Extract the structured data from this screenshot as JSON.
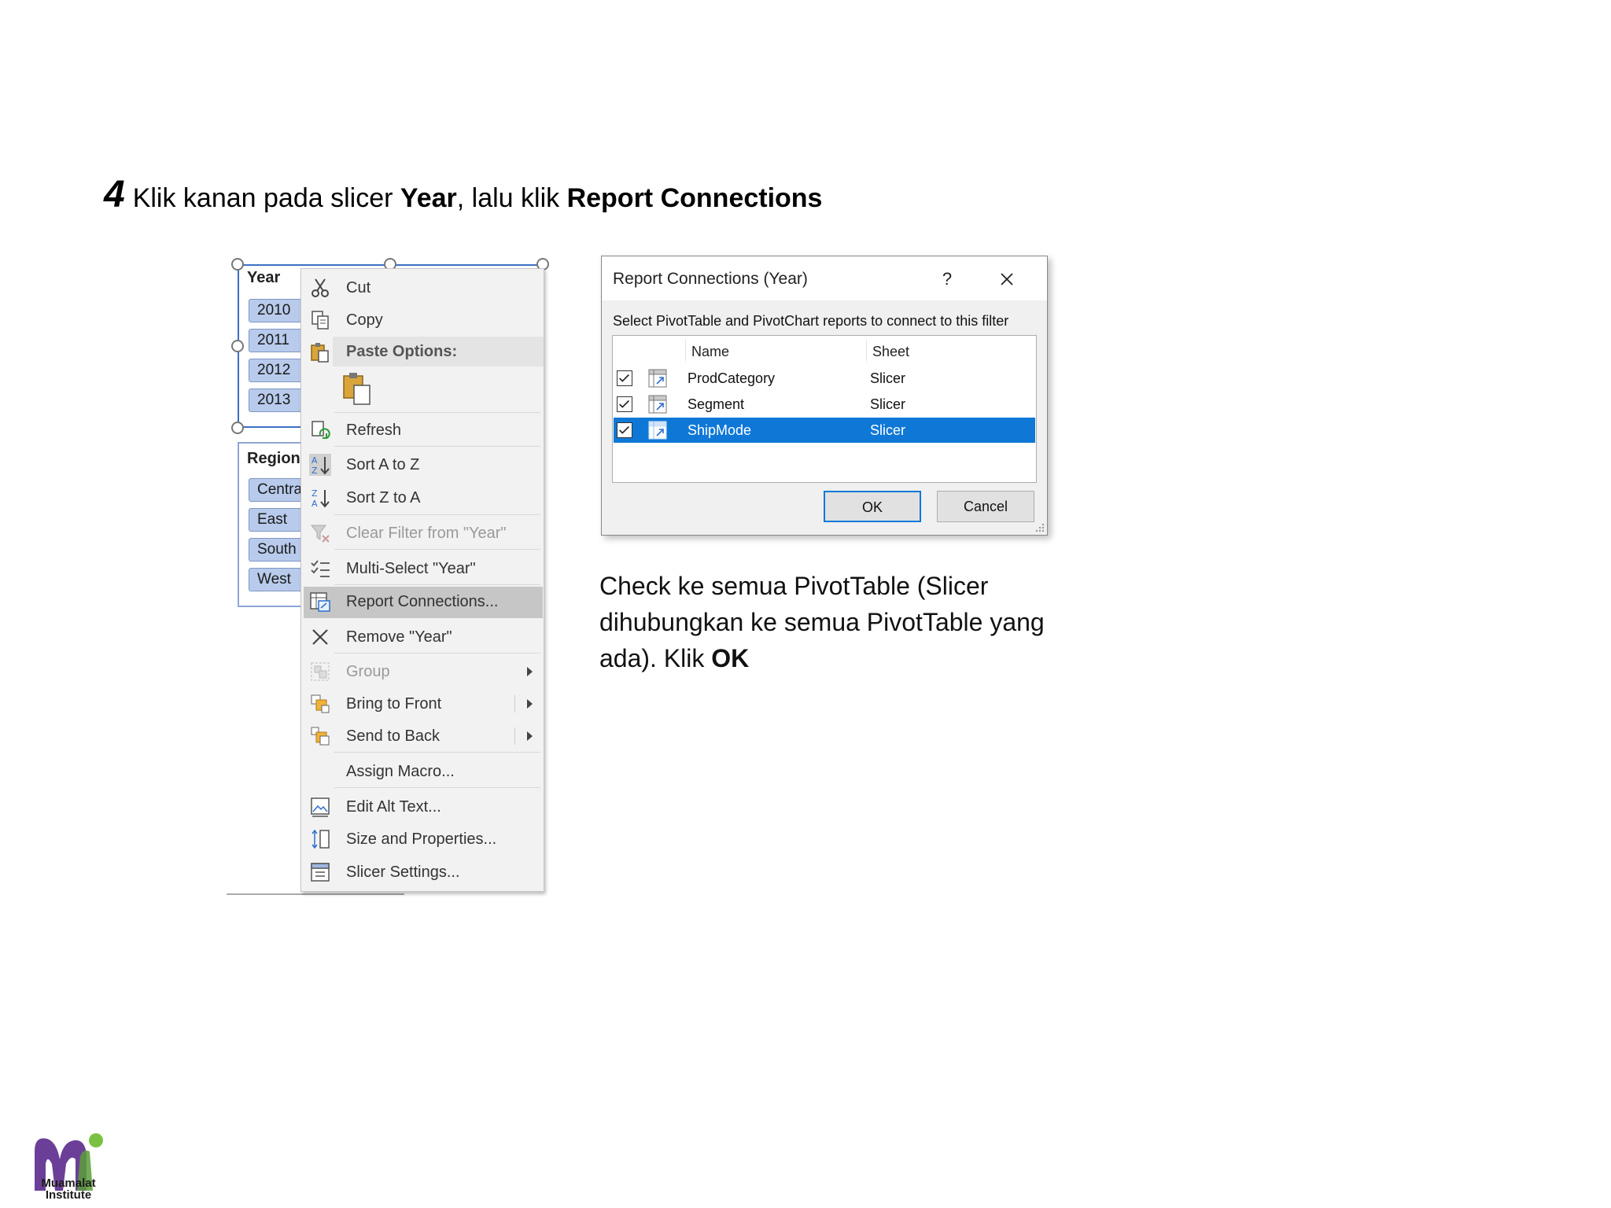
{
  "instruction": {
    "step_number": "4",
    "text_before": "Klik kanan pada slicer ",
    "year_bold": "Year",
    "text_middle": ", lalu klik ",
    "report_bold": "Report Connections"
  },
  "slicer_year": {
    "header": "Year",
    "items": [
      "2010",
      "2011",
      "2012",
      "2013"
    ]
  },
  "slicer_region": {
    "header": "Region",
    "items": [
      "Central",
      "East",
      "South",
      "West"
    ]
  },
  "context_menu": {
    "cut": "Cut",
    "copy": "Copy",
    "paste_options": "Paste Options:",
    "refresh": "Refresh",
    "sort_az": "Sort A to Z",
    "sort_za": "Sort Z to A",
    "clear_filter": "Clear Filter from \"Year\"",
    "multi_select": "Multi-Select \"Year\"",
    "report_connections": "Report Connections...",
    "remove": "Remove \"Year\"",
    "group": "Group",
    "bring_to_front": "Bring to Front",
    "send_to_back": "Send to Back",
    "assign_macro": "Assign Macro...",
    "edit_alt_text": "Edit Alt Text...",
    "size_properties": "Size and Properties...",
    "slicer_settings": "Slicer Settings..."
  },
  "dialog": {
    "title": "Report Connections (Year)",
    "help": "?",
    "instruction": "Select PivotTable and PivotChart reports to connect to this filter",
    "col_name": "Name",
    "col_sheet": "Sheet",
    "rows": [
      {
        "name": "ProdCategory",
        "sheet": "Slicer",
        "checked": true
      },
      {
        "name": "Segment",
        "sheet": "Slicer",
        "checked": true
      },
      {
        "name": "ShipMode",
        "sheet": "Slicer",
        "checked": true
      }
    ],
    "ok": "OK",
    "cancel": "Cancel",
    "selection_color": "#0f78d7"
  },
  "explanation": {
    "text": "Check ke semua PivotTable (Slicer dihubungkan ke semua PivotTable yang ada). Klik ",
    "bold": "OK"
  },
  "logo": {
    "line1": "Muamalat",
    "line2": "Institute",
    "colors": {
      "purple": "#6b3f98",
      "green": "#7ac143"
    }
  }
}
